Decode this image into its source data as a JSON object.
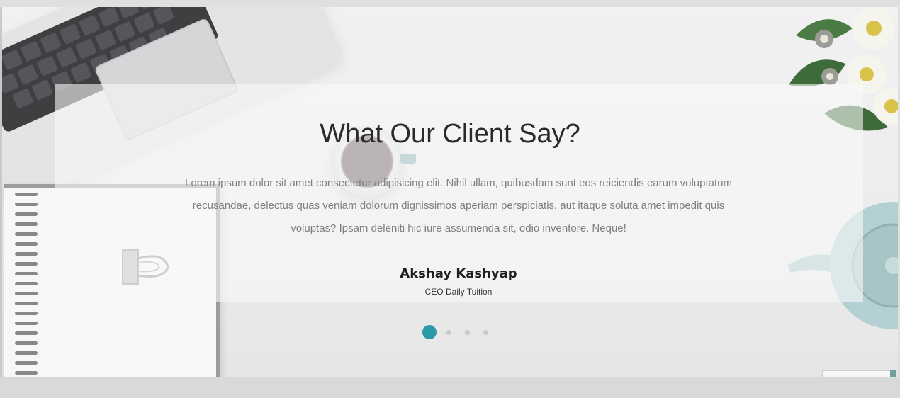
{
  "testimonial": {
    "heading": "What Our Client Say?",
    "quote": "Lorem ipsum dolor sit amet consectetur adipisicing elit. Nihil ullam, quibusdam sunt eos reiciendis earum voluptatum recusandae, delectus quas veniam dolorum dignissimos aperiam perspiciatis, aut itaque soluta amet impedit quis voluptas? Ipsam deleniti hic iure assumenda sit, odio inventore. Neque!",
    "author_name": "Akshay Kashyap",
    "author_role": "CEO Daily Tuition"
  },
  "carousel": {
    "total_slides": 4,
    "active_slide": 1
  },
  "colors": {
    "accent": "#2c9aa6",
    "inactive_dot": "#c8c8ca",
    "heading": "#2a2a2a",
    "body_text": "#7f7f82"
  },
  "background_props": [
    "laptop",
    "notebook",
    "binder-clip",
    "coffee-cup",
    "flowers",
    "teapot"
  ]
}
